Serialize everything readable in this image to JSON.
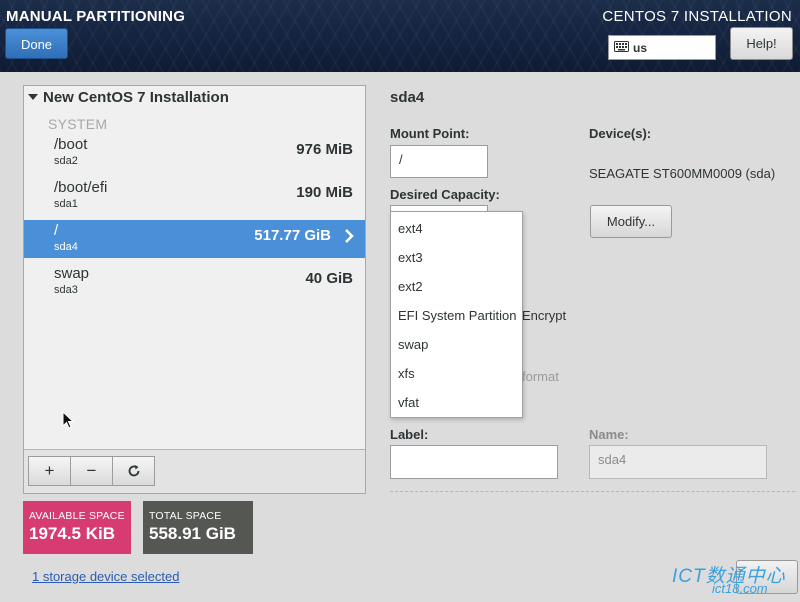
{
  "header": {
    "title": "MANUAL PARTITIONING",
    "done_label": "Done",
    "product": "CENTOS 7 INSTALLATION",
    "keyboard_layout": "us",
    "help_label": "Help!"
  },
  "tree": {
    "installation_label": "New CentOS 7 Installation",
    "system_label": "SYSTEM",
    "partitions": [
      {
        "mount": "/boot",
        "device": "sda2",
        "size": "976 MiB"
      },
      {
        "mount": "/boot/efi",
        "device": "sda1",
        "size": "190 MiB"
      },
      {
        "mount": "/",
        "device": "sda4",
        "size": "517.77 GiB",
        "selected": true
      },
      {
        "mount": "swap",
        "device": "sda3",
        "size": "40 GiB"
      }
    ],
    "toolbar": {
      "add": "+",
      "remove": "−",
      "refresh": "⟳"
    }
  },
  "space": {
    "available_label": "AVAILABLE SPACE",
    "available_value": "1974.5 KiB",
    "total_label": "TOTAL SPACE",
    "total_value": "558.91 GiB"
  },
  "storage_link": "1 storage device selected",
  "details": {
    "title": "sda4",
    "mount_point_label": "Mount Point:",
    "mount_point_value": "/",
    "desired_capacity_label": "Desired Capacity:",
    "devices_label": "Device(s):",
    "device_name": "SEAGATE ST600MM0009 (sda)",
    "modify_label": "Modify...",
    "encrypt_partial": "Encrypt",
    "format_partial": "format",
    "label_label": "Label:",
    "label_value": "",
    "name_label": "Name:",
    "name_value": "sda4"
  },
  "filesystem_menu": {
    "options": [
      "ext4",
      "ext3",
      "ext2",
      "EFI System Partition",
      "swap",
      "xfs",
      "vfat"
    ]
  },
  "watermark": {
    "main": "ICT数通中心",
    "sub": "ict18.com"
  },
  "colors": {
    "header_bg": "#14233f",
    "selected_row": "#4a90d9",
    "available_space": "#d63b72",
    "total_space": "#555753",
    "done_button": "#3a7fc8"
  }
}
